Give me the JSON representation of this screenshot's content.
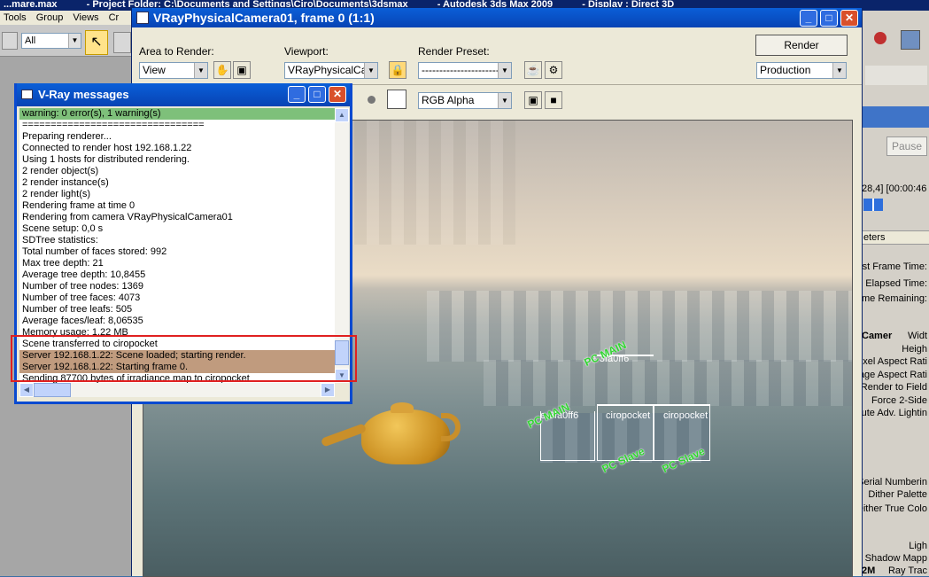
{
  "max": {
    "title_parts": [
      "...mare.max",
      "- Project Folder: C:\\Documents and Settings\\Ciro\\Documents\\3dsmax",
      "- Autodesk 3ds Max 2009",
      "- Display : Direct 3D"
    ],
    "menu": [
      "Tools",
      "Group",
      "Views",
      "Cr"
    ],
    "selection_filter": "All",
    "right_panel": {
      "pause_label": "Pause",
      "frame_info": "28,4] [00:00:46",
      "section_label": "eters",
      "stats": [
        "ast Frame Time:",
        "Elapsed Time:",
        "me Remaining:"
      ],
      "props": [
        "Camer",
        "Widt",
        "Heigh",
        "ixel Aspect Rati",
        "age Aspect Rati",
        "Render to Field",
        "Force 2-Side",
        "ute Adv. Lightin",
        "Serial Numberin",
        "Dither Palette",
        "Dither True Colo",
        "Ligh",
        "Shadow Mapp",
        "2M",
        "Ray Trac"
      ]
    }
  },
  "render_window": {
    "title": "VRayPhysicalCamera01, frame 0 (1:1)",
    "area_label": "Area to Render:",
    "area_value": "View",
    "viewport_label": "Viewport:",
    "viewport_value": "VRayPhysicalCam",
    "preset_label": "Render Preset:",
    "preset_value": "-------------------------",
    "render_button": "Render",
    "production_value": "Production",
    "channel_value": "RGB Alpha",
    "buckets": [
      {
        "name": "ciropocket"
      },
      {
        "name": "ciropocket"
      },
      {
        "name": "e-3fa0ff6"
      },
      {
        "name": "e-3fa0ff6"
      }
    ],
    "tags": [
      "PC MAIN",
      "PC MAIN",
      "PC Slave",
      "PC Slave"
    ]
  },
  "vray_messages": {
    "title": "V-Ray messages",
    "lines": [
      "warning: 0 error(s), 1 warning(s)",
      "================================",
      "Preparing renderer...",
      "Connected to render host 192.168.1.22",
      "Using 1 hosts for distributed rendering.",
      "2 render object(s)",
      "2 render instance(s)",
      "2 render light(s)",
      "Rendering frame at time 0",
      "Rendering from camera VRayPhysicalCamera01",
      "Scene setup: 0,0 s",
      "SDTree statistics:",
      "Total number of faces stored: 992",
      "Max tree depth: 21",
      "Average tree depth: 10,8455",
      "Number of tree nodes: 1369",
      "Number of tree faces: 4073",
      "Number of tree leafs: 505",
      "Average faces/leaf: 8,06535",
      "Memory usage: 1,22 MB",
      "Scene transferred to ciropocket",
      "Server 192.168.1.22: Scene loaded; starting render.",
      "Server 192.168.1.22: Starting frame 0.",
      "Sending 87700 bytes of irradiance map to ciropocket"
    ]
  },
  "colors": {
    "title_blue": "#0a5fd8",
    "warning_green": "#7ec07a",
    "server_highlight": "#c09b7e",
    "annotation_red": "#e02020",
    "tag_green": "#2fd42f"
  }
}
